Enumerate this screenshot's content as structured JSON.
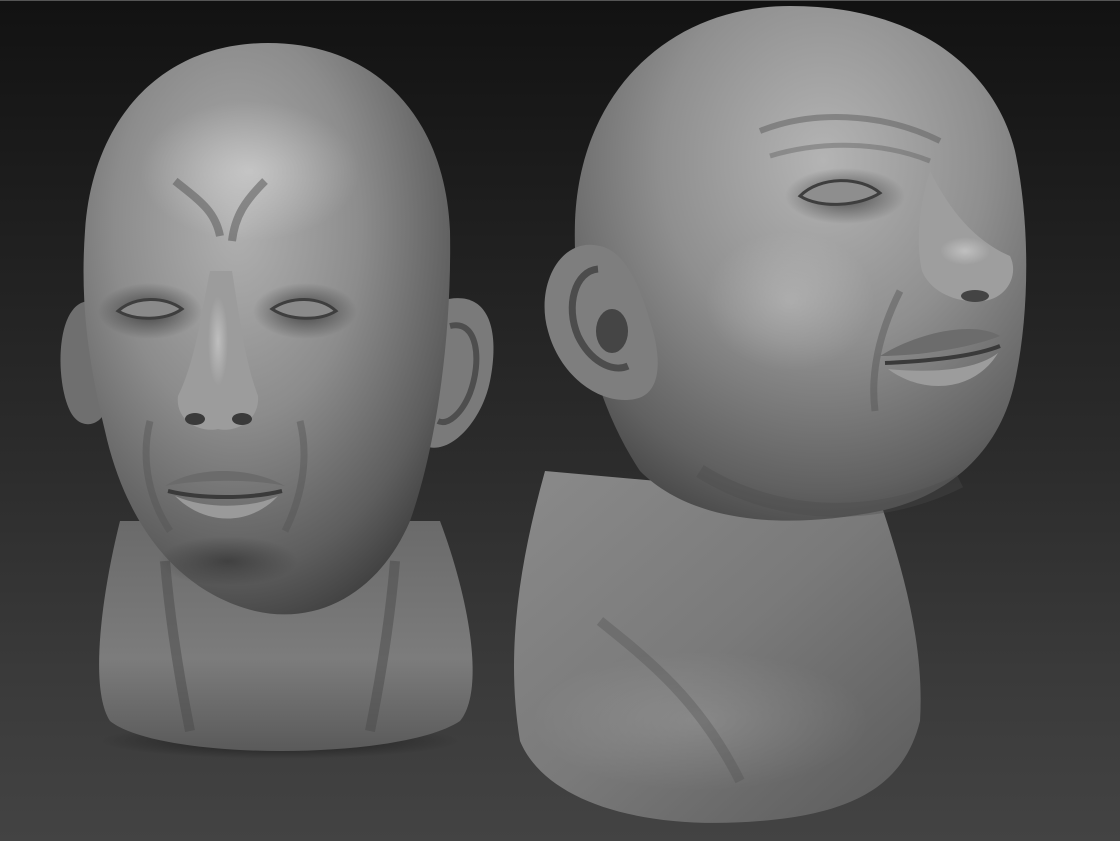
{
  "scene": {
    "type": "3d-sculpt-viewport",
    "material": "matcap-gray",
    "background": {
      "top": "#121212",
      "bottom": "#434343"
    },
    "models": [
      {
        "name": "head-front-view",
        "view": "front"
      },
      {
        "name": "head-three-quarter-view",
        "view": "three-quarter-right"
      }
    ]
  }
}
